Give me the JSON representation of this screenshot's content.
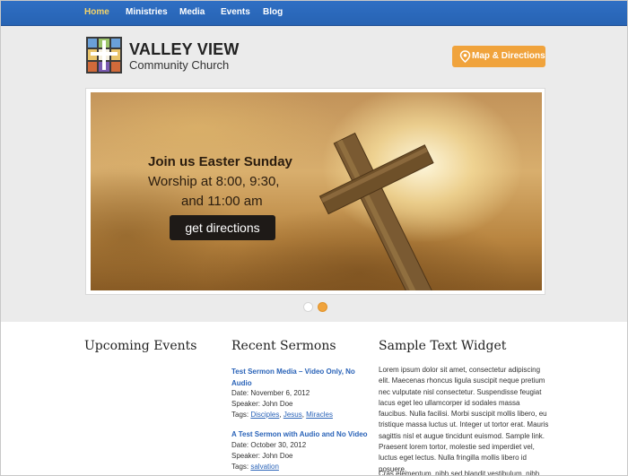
{
  "nav": {
    "items": [
      {
        "label": "Home",
        "active": true
      },
      {
        "label": "Ministries",
        "active": false
      },
      {
        "label": "Media",
        "active": false
      },
      {
        "label": "Events",
        "active": false
      },
      {
        "label": "Blog",
        "active": false
      }
    ]
  },
  "header": {
    "brand_line1": "VALLEY VIEW",
    "brand_line2": "Community Church",
    "map_button": "Map & Directions"
  },
  "slider": {
    "line1": "Join us Easter Sunday",
    "line2": "Worship at 8:00, 9:30,",
    "line3": "and 11:00 am",
    "button": "get directions",
    "active_slide": 2,
    "slide_count": 2
  },
  "events": {
    "heading": "Upcoming Events"
  },
  "sermons": {
    "heading": "Recent Sermons",
    "items": [
      {
        "title_line1": "Test Sermon Media – Video Only, No",
        "title_line2": "Audio",
        "date": "Date: November 6, 2012",
        "speaker": "Speaker: John Doe",
        "tags_label": "Tags: ",
        "tags": [
          "Disciples",
          "Jesus",
          "Miracles"
        ]
      },
      {
        "title_line1": "A Test Sermon with Audio and No Video",
        "date": "Date: October 30, 2012",
        "speaker": "Speaker: John Doe",
        "tags_label": "Tags: ",
        "tags": [
          "salvation"
        ]
      }
    ]
  },
  "widget": {
    "heading": "Sample Text Widget",
    "body": "Lorem ipsum dolor sit amet, consectetur adipiscing elit. Maecenas rhoncus ligula suscipit neque pretium nec vulputate nisl consectetur. Suspendisse feugiat lacus eget leo ullamcorper id sodales massa faucibus. Nulla facilisi. Morbi suscipit mollis libero, eu tristique massa luctus ut. Integer ut tortor erat. Mauris sagittis nisl et augue tincidunt euismod. Sample link. Praesent lorem tortor, molestie sed imperdiet vel, luctus eget lectus. Nulla fringilla mollis libero id posuere.",
    "body2": "Cras elementum, nibh sed blandit vestibulum, nibh"
  },
  "colors": {
    "nav_bg": "#2c6bbf",
    "nav_active": "#f3d36a",
    "accent": "#f0a33c",
    "link": "#2a63b8"
  },
  "icons": {
    "logo": "stained-glass-cross-logo",
    "map_pin": "map-pin-icon"
  }
}
